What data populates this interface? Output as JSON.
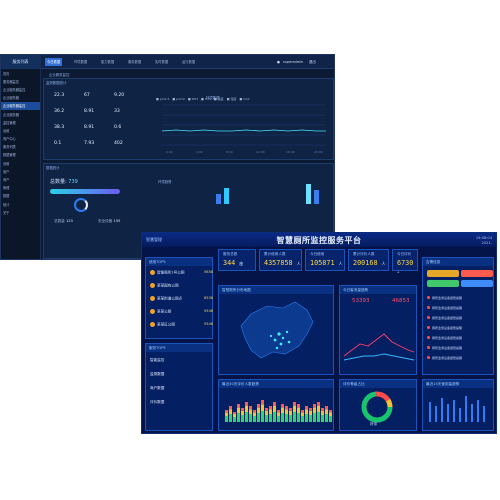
{
  "back_window": {
    "brand": "服务列表",
    "sidebar_items": [
      "首页",
      "服务器监控",
      "企业服务器监控",
      "企业服务器",
      "企业服务器监控",
      "企业服务器",
      "监控管理",
      "运维",
      "商户中心",
      "服务列表",
      "数据管理",
      "设置",
      "用户",
      "商户",
      "管理",
      "数据",
      "统计",
      "关于"
    ],
    "tabs": [
      "今日数据",
      "环境数据",
      "能力数据",
      "服务数据",
      "实时数据",
      "运行数据"
    ],
    "user": "superadmin",
    "logout": "退出",
    "overview_title": "监测数据统计",
    "subtitle": "企业服务监控",
    "stats": [
      {
        "value": "22.3",
        "label": ""
      },
      {
        "value": "67",
        "label": ""
      },
      {
        "value": "9.20",
        "label": ""
      },
      {
        "value": "36.2",
        "label": ""
      },
      {
        "value": "8.91",
        "label": ""
      },
      {
        "value": "33",
        "label": ""
      },
      {
        "value": "38.3",
        "label": ""
      },
      {
        "value": "8.91",
        "label": ""
      },
      {
        "value": "0.6",
        "label": ""
      },
      {
        "value": "0.1",
        "label": ""
      },
      {
        "value": "7.93",
        "label": ""
      },
      {
        "value": "402",
        "label": ""
      }
    ],
    "line_chart_title": "环境数据",
    "bottom_title": "数据统计",
    "total_label": "总数量:",
    "total_value": "739",
    "bottom_chart_title": "环境趋势",
    "footer_labels": [
      "总数量",
      "安全设备"
    ],
    "footer_values": [
      "123",
      "155"
    ]
  },
  "dashboard": {
    "title": "智慧厕所监控服务平台",
    "left_brand": "智慧管理",
    "datetime_line1": "19:08:04",
    "datetime_line2": "2021-",
    "kpis": [
      {
        "label": "服务总数",
        "value": "344",
        "unit": "座"
      },
      {
        "label": "累计使用人数",
        "value": "4357858",
        "unit": "人"
      },
      {
        "label": "今日使用",
        "value": "105871",
        "unit": "人"
      },
      {
        "label": "累计评价人数",
        "value": "200168",
        "unit": "人"
      },
      {
        "label": "今日评价",
        "value": "6730",
        "unit": "+"
      }
    ],
    "rank_title": "使用TOP5",
    "ranks": [
      {
        "name": "智能厕所1号公厕",
        "value": "5658"
      },
      {
        "name": "某某国有公厕",
        "value": ""
      },
      {
        "name": "某某街道公厕点",
        "value": "6536"
      },
      {
        "name": "某某公厕",
        "value": "5546"
      },
      {
        "name": "某某区公厕",
        "value": "5546"
      }
    ],
    "rank2_title": "服务TOP5",
    "rank2_items": [
      "智能监控",
      "监测数据",
      "商户数据",
      "评价数据"
    ],
    "map_title": "智慧厕所分布地图",
    "today_title": "今日客流量趋势",
    "today_left": "53393",
    "today_right": "46853",
    "today_left_label": "",
    "today_right_label": "",
    "alarm_title": "告警信息",
    "alarm_buttons": [
      {
        "label": "",
        "color": "#e6a829"
      },
      {
        "label": "",
        "color": "#ff5a4e"
      },
      {
        "label": "",
        "color": "#42c96b"
      },
      {
        "label": "",
        "color": "#3f8cff"
      }
    ],
    "alarm_records": [
      "厕所监测设备报警提醒",
      "厕所监测设备报警提醒",
      "厕所监测设备报警提醒",
      "厕所监测设备报警提醒",
      "厕所监测设备报警提醒",
      "厕所监测设备报警提醒",
      "厕所监测设备报警提醒"
    ],
    "bars_title": "最近30天评价人数趋势",
    "donut_title": "评价等级占比",
    "donut_label": "好评",
    "right_bottom_title": "最近15天使用量趋势"
  }
}
